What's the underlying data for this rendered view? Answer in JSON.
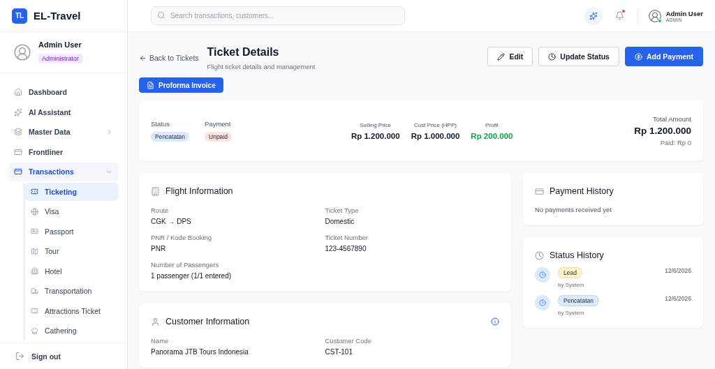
{
  "brand": {
    "logo": "TL",
    "name": "EL-Travel"
  },
  "user": {
    "name": "Admin User",
    "role": "Administrator"
  },
  "nav": [
    {
      "label": "Dashboard",
      "selected": false
    },
    {
      "label": "AI Assistant",
      "selected": false
    },
    {
      "label": "Master Data",
      "selected": false,
      "expanded": false
    },
    {
      "label": "Frontliner",
      "selected": false
    },
    {
      "label": "Transactions",
      "selected": true,
      "expanded": true,
      "children": [
        {
          "label": "Ticketing",
          "selected": true
        },
        {
          "label": "Visa",
          "selected": false
        },
        {
          "label": "Passport",
          "selected": false
        },
        {
          "label": "Tour",
          "selected": false
        },
        {
          "label": "Hotel",
          "selected": false
        },
        {
          "label": "Transportation",
          "selected": false
        },
        {
          "label": "Attractions Ticket",
          "selected": false
        },
        {
          "label": "Cathering",
          "selected": false
        }
      ]
    }
  ],
  "sign_out": "Sign out",
  "search": {
    "placeholder": "Search transactions, customers..."
  },
  "header_user": {
    "name": "Admin User",
    "role": "ADMIN",
    "online": true
  },
  "notifications": {
    "unread": true
  },
  "page": {
    "back": "Back to Tickets",
    "title": "Ticket Details",
    "subtitle": "Flight ticket details and management",
    "actions": [
      {
        "label": "Edit",
        "kind": "edit"
      },
      {
        "label": "Update Status",
        "kind": "status"
      },
      {
        "label": "Add Payment",
        "kind": "payment"
      }
    ],
    "invoice_button": "Proforma Invoice"
  },
  "summary": {
    "badges": [
      {
        "label": "Status",
        "value": "Pencatatan",
        "color": "#dbe8fd"
      },
      {
        "label": "Payment",
        "value": "Unpaid",
        "color": "#fde2e2"
      }
    ],
    "prices": [
      {
        "label": "Selling Price",
        "value": "Rp 1.200.000",
        "kind": "plain"
      },
      {
        "label": "Cost Price (HPP)",
        "value": "Rp 1.000.000",
        "kind": "plain"
      },
      {
        "label": "Profit",
        "value": "Rp 200.000",
        "kind": "profit"
      }
    ],
    "total": {
      "label": "Total Amount",
      "value": "Rp 1.200.000",
      "paid": "Paid: Rp 0"
    }
  },
  "flight": {
    "title": "Flight Information",
    "fields": [
      {
        "label": "Route",
        "value": "CGK → DPS"
      },
      {
        "label": "Ticket Type",
        "value": "Domestic"
      },
      {
        "label": "PNR / Kode Booking",
        "value": "PNR"
      },
      {
        "label": "Ticket Number",
        "value": "123-4567890"
      },
      {
        "label": "Number of Passengers",
        "value": "1 passenger (1/1 entered)"
      }
    ]
  },
  "customer": {
    "title": "Customer Information",
    "fields": [
      {
        "label": "Name",
        "value": "Panorama JTB Tours Indonesia"
      },
      {
        "label": "Customer Code",
        "value": "CST-101"
      }
    ]
  },
  "payment_history": {
    "title": "Payment History",
    "empty": "No payments received yet"
  },
  "status_history": {
    "title": "Status History",
    "items": [
      {
        "status": "Lead",
        "by": "by System",
        "date": "12/6/2026",
        "color": "#fef3c7"
      },
      {
        "status": "Pencatatan",
        "by": "by System",
        "date": "12/6/2026",
        "color": "#dbeafe"
      }
    ]
  }
}
